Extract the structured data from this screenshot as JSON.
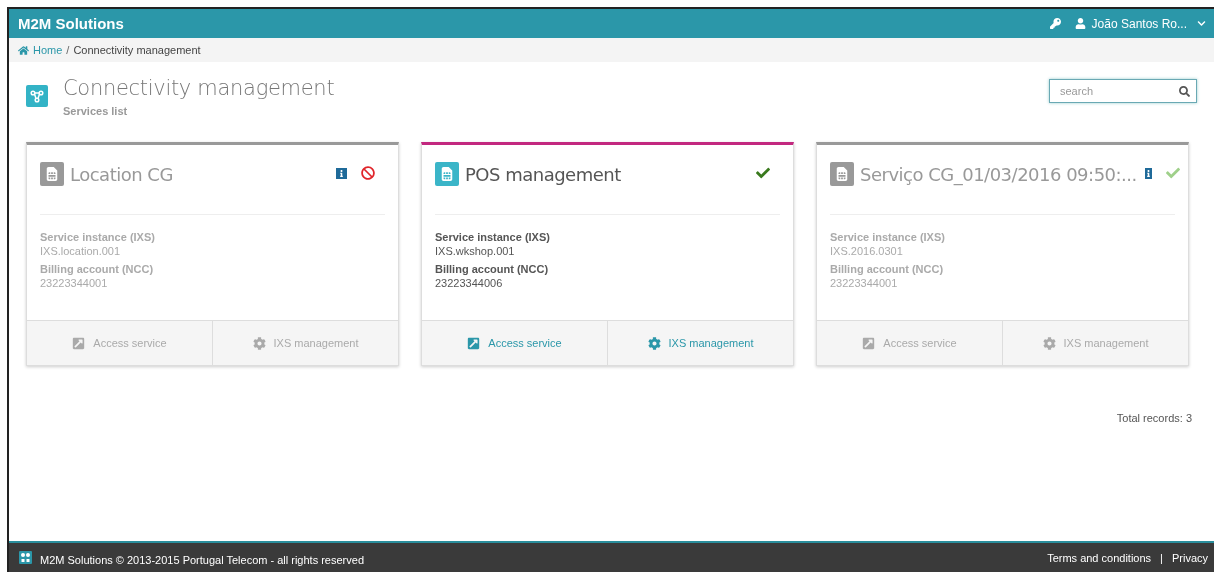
{
  "header": {
    "brand": "M2M Solutions",
    "user": "João Santos Ro..."
  },
  "breadcrumb": [
    {
      "label": "Home",
      "kind": "link"
    },
    {
      "label": "Connectivity management",
      "kind": "current"
    }
  ],
  "separator": "/",
  "page": {
    "title": "Connectivity management",
    "subtitle": "Services list"
  },
  "search": {
    "placeholder": "search"
  },
  "cards": [
    {
      "title": "Location CG",
      "selected": false,
      "info": true,
      "kind": "blocked",
      "fields": [
        {
          "label": "Service instance (IXS)",
          "value": "IXS.location.001"
        },
        {
          "label": "Billing account (NCC)",
          "value": "23223344001"
        }
      ],
      "actions": [
        {
          "label": "Access service",
          "kind": "open"
        },
        {
          "label": "IXS management",
          "kind": "settings"
        }
      ]
    },
    {
      "title": "POS management",
      "selected": true,
      "info": false,
      "kind": "active",
      "fields": [
        {
          "label": "Service instance (IXS)",
          "value": "IXS.wkshop.001"
        },
        {
          "label": "Billing account (NCC)",
          "value": "23223344006"
        }
      ],
      "actions": [
        {
          "label": "Access service",
          "kind": "open"
        },
        {
          "label": "IXS management",
          "kind": "settings"
        }
      ]
    },
    {
      "title": "Serviço CG_01/03/2016 09:50:...",
      "selected": false,
      "info": true,
      "kind": "pending",
      "fields": [
        {
          "label": "Service instance (IXS)",
          "value": "IXS.2016.0301"
        },
        {
          "label": "Billing account (NCC)",
          "value": "23223344001"
        }
      ],
      "actions": [
        {
          "label": "Access service",
          "kind": "open"
        },
        {
          "label": "IXS management",
          "kind": "settings"
        }
      ]
    }
  ],
  "total": "Total records: 3",
  "footer": {
    "copyright": "M2M Solutions © 2013-2015 Portugal Telecom - all rights reserved",
    "links": [
      "Terms and conditions",
      "Privacy"
    ],
    "separator": "|"
  }
}
